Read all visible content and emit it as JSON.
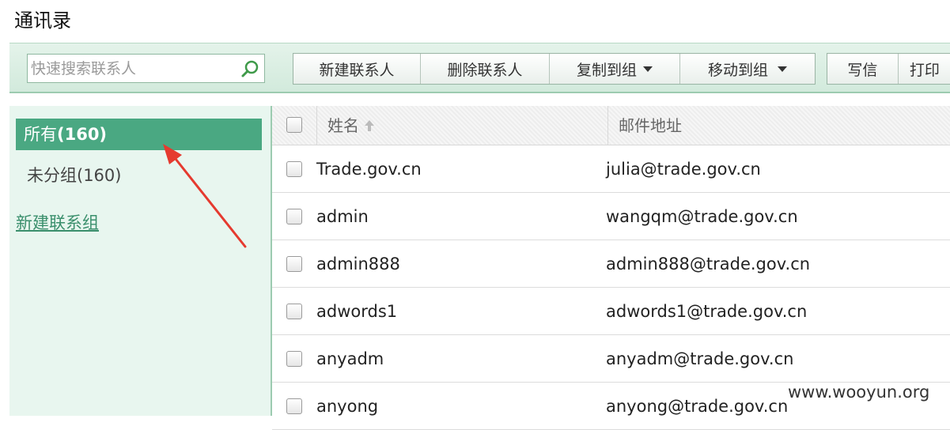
{
  "page": {
    "title": "通讯录"
  },
  "toolbar": {
    "search_placeholder": "快速搜索联系人",
    "buttons": {
      "new_contact": "新建联系人",
      "delete_contact": "删除联系人",
      "copy_to_group": "复制到组",
      "move_to_group": "移动到组",
      "write_mail": "写信",
      "print": "打印"
    }
  },
  "sidebar": {
    "group_all_label": "所有",
    "group_all_count": "(160)",
    "group_ungrouped": "未分组(160)",
    "new_group_link": "新建联系组"
  },
  "table": {
    "columns": {
      "name": "姓名",
      "email": "邮件地址"
    },
    "sort_icon": "arrow-up-icon",
    "rows": [
      {
        "name": "Trade.gov.cn",
        "email": "julia@trade.gov.cn"
      },
      {
        "name": "admin",
        "email": "wangqm@trade.gov.cn"
      },
      {
        "name": "admin888",
        "email": "admin888@trade.gov.cn"
      },
      {
        "name": "adwords1",
        "email": "adwords1@trade.gov.cn"
      },
      {
        "name": "anyadm",
        "email": "anyadm@trade.gov.cn"
      },
      {
        "name": "anyong",
        "email": "anyong@trade.gov.cn"
      }
    ]
  },
  "watermark": "www.wooyun.org",
  "colors": {
    "accent": "#4aa882",
    "sidebar_bg": "#e8f6ef",
    "annotation_arrow": "#e53a2f"
  }
}
